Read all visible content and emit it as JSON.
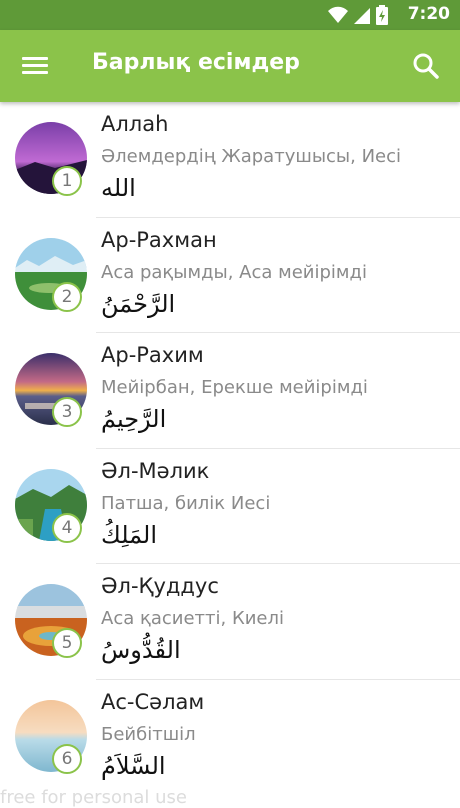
{
  "status_bar": {
    "time": "7:20"
  },
  "app_bar": {
    "title": "Барлық есімдер",
    "menu_icon": "menu-icon",
    "search_icon": "search-icon"
  },
  "colors": {
    "accent": "#8bc34a",
    "status": "#5f9a38"
  },
  "names": [
    {
      "name": "Аллаh",
      "meaning": "Әлемдердің Жаратушысы, Иесі",
      "arabic": "الله",
      "number": "1"
    },
    {
      "name": "Ар-Рахман",
      "meaning": "Аса рақымды, Аса мейірімді",
      "arabic": "الرَّحْمَنُ",
      "number": "2"
    },
    {
      "name": "Ар-Рахим",
      "meaning": "Мейірбан, Ерекше мейірімді",
      "arabic": "الرَّحِيمُ",
      "number": "3"
    },
    {
      "name": "Әл-Мәлик",
      "meaning": "Патша, билік Иесі",
      "arabic": "المَلِكُ",
      "number": "4"
    },
    {
      "name": "Әл-Қуддус",
      "meaning": "Аса қасиетті, Киелі",
      "arabic": "القُدُّوسُ",
      "number": "5"
    },
    {
      "name": "Ас-Сәлам",
      "meaning": "Бейбітшіл",
      "arabic": "السَّلاَمُ",
      "number": "6"
    }
  ],
  "watermark": "free for personal use"
}
